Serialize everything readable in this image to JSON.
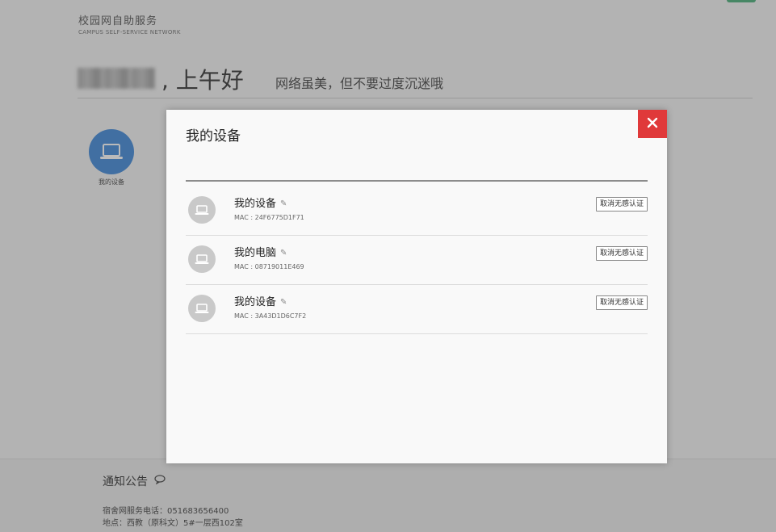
{
  "brand": {
    "name_cn": "校园网自助服务",
    "name_en": "CAMPUS SELF-SERVICE NETWORK"
  },
  "greeting": {
    "text": ", 上午好",
    "tagline": "网络虽美，但不要过度沉迷哦"
  },
  "sidebar": {
    "items": [
      {
        "label": "我的设备",
        "icon": "laptop-icon"
      }
    ]
  },
  "footer": {
    "notice_title": "通知公告",
    "phone_line": "宿舍网服务电话：051683656400",
    "address_line": "地点：西教（原科文）5#一层西102室"
  },
  "modal": {
    "title": "我的设备",
    "close_icon": "close-icon",
    "devices": [
      {
        "name": "我的设备",
        "mac": "MAC : 24F6775D1F71",
        "action": "取消无感认证"
      },
      {
        "name": "我的电脑",
        "mac": "MAC : 08719011E469",
        "action": "取消无感认证"
      },
      {
        "name": "我的设备",
        "mac": "MAC : 3A43D1D6C7F2",
        "action": "取消无感认证"
      }
    ]
  },
  "colors": {
    "accent_blue": "#2f7fd6",
    "close_red": "#e0393a",
    "status_green": "#3aa76d"
  }
}
